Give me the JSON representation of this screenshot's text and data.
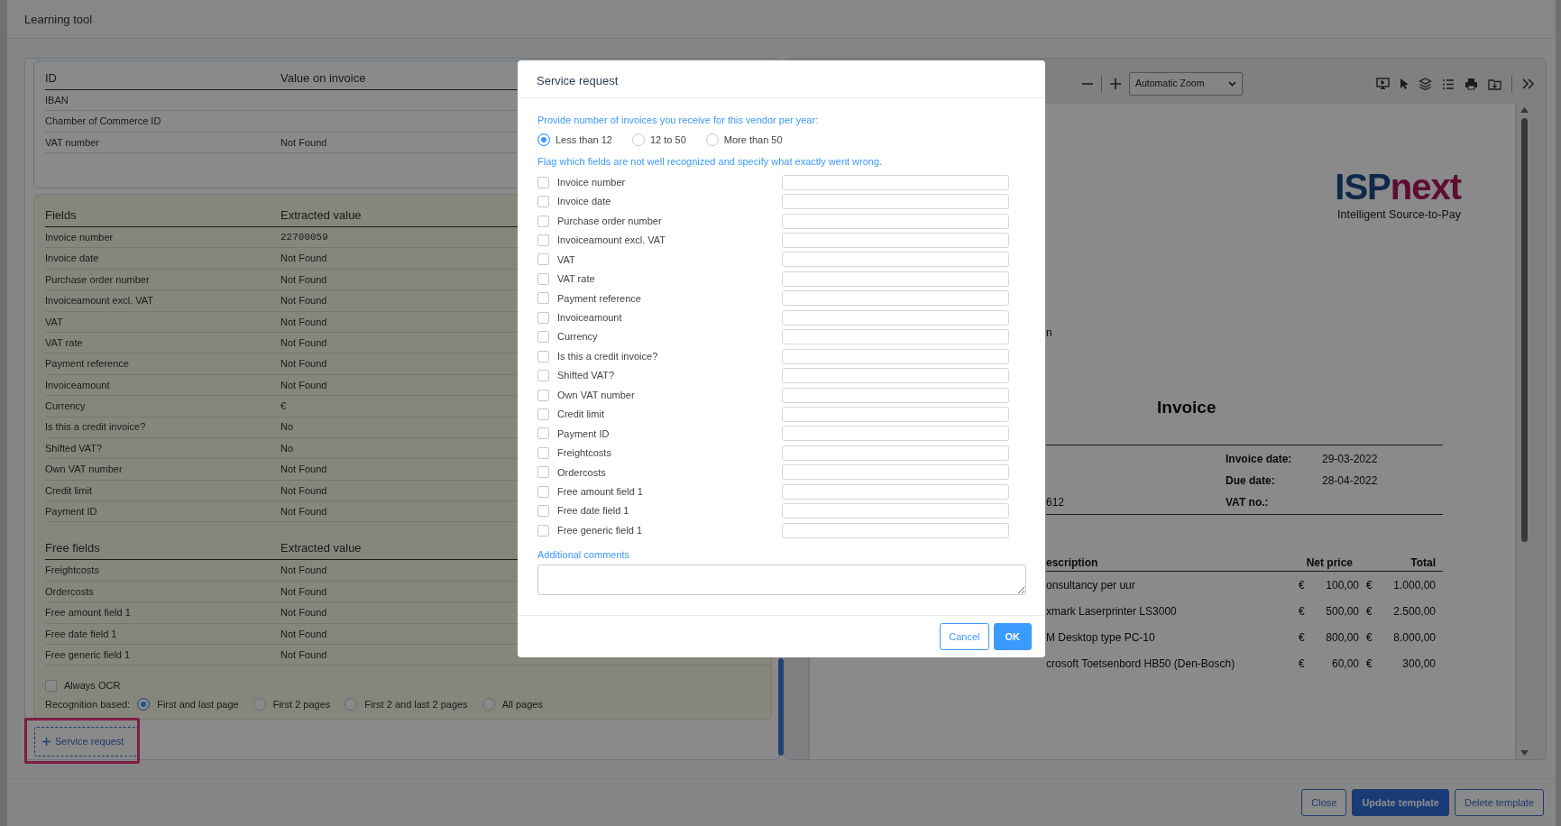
{
  "window": {
    "title": "Learning tool"
  },
  "id_table": {
    "columns": [
      "ID",
      "Value on invoice"
    ],
    "rows": [
      {
        "label": "IBAN"
      },
      {
        "label": "Chamber of Commerce ID"
      },
      {
        "label": "VAT number",
        "value": "Not Found"
      }
    ]
  },
  "fields_table": {
    "columns": [
      "Fields",
      "Extracted value"
    ],
    "rows": [
      {
        "label": "Invoice number",
        "value": "22700059"
      },
      {
        "label": "Invoice date",
        "value": "Not Found"
      },
      {
        "label": "Purchase order number",
        "value": "Not Found"
      },
      {
        "label": "Invoiceamount excl. VAT",
        "value": "Not Found"
      },
      {
        "label": "VAT",
        "value": "Not Found"
      },
      {
        "label": "VAT rate",
        "value": "Not Found"
      },
      {
        "label": "Payment reference",
        "value": "Not Found"
      },
      {
        "label": "Invoiceamount",
        "value": "Not Found"
      },
      {
        "label": "Currency",
        "value": "€"
      },
      {
        "label": "Is this a credit invoice?",
        "value": "No"
      },
      {
        "label": "Shifted VAT?",
        "value": "No"
      },
      {
        "label": "Own VAT number",
        "value": "Not Found"
      },
      {
        "label": "Credit limit",
        "value": "Not Found"
      },
      {
        "label": "Payment ID",
        "value": "Not Found"
      }
    ]
  },
  "free_fields_table": {
    "columns": [
      "Free fields",
      "Extracted value"
    ],
    "rows": [
      {
        "label": "Freightcosts",
        "value": "Not Found"
      },
      {
        "label": "Ordercosts",
        "value": "Not Found"
      },
      {
        "label": "Free amount field 1",
        "value": "Not Found"
      },
      {
        "label": "Free date field 1",
        "value": "Not Found"
      },
      {
        "label": "Free generic field 1",
        "value": "Not Found"
      }
    ]
  },
  "always_ocr": {
    "label": "Always OCR",
    "checked": false
  },
  "recognition": {
    "label": "Recognition based:",
    "options": [
      {
        "label": "First and last page",
        "selected": true
      },
      {
        "label": "First 2 pages",
        "selected": false
      },
      {
        "label": "First 2 and last 2 pages",
        "selected": false
      },
      {
        "label": "All pages",
        "selected": false
      }
    ]
  },
  "service_request_button": {
    "label": "Service request",
    "highlighted": true
  },
  "viewer": {
    "zoom": "Automatic Zoom",
    "document": {
      "logo_primary": "ISP",
      "logo_accent": "next",
      "tagline": "Intelligent Source-to-Pay",
      "fragment_1": "n",
      "title": "Invoice",
      "meta": [
        {
          "label": "Invoice date:",
          "value": "29-03-2022"
        },
        {
          "label": "Due date:",
          "value": "28-04-2022"
        },
        {
          "label": "VAT no.:"
        }
      ],
      "fragment_2": "612",
      "columns": [
        "escription",
        "Net price",
        "Total"
      ],
      "lines": [
        {
          "description": "onsultancy per uur",
          "currency_1": "€",
          "net_price": "100,00",
          "currency_2": "€",
          "total": "1.000,00"
        },
        {
          "description": "xmark Laserprinter LS3000",
          "currency_1": "€",
          "net_price": "500,00",
          "currency_2": "€",
          "total": "2.500,00"
        },
        {
          "description": "M Desktop type PC-10",
          "currency_1": "€",
          "net_price": "800,00",
          "currency_2": "€",
          "total": "8.000,00"
        },
        {
          "description": "crosoft Toetsenbord HB50 (Den-Bosch)",
          "currency_1": "€",
          "net_price": "60,00",
          "currency_2": "€",
          "total": "300,00"
        }
      ]
    }
  },
  "footer_buttons": [
    {
      "label": "Close",
      "kind": "outline"
    },
    {
      "label": "Update template",
      "kind": "primary"
    },
    {
      "label": "Delete template",
      "kind": "outline"
    }
  ],
  "dialog": {
    "title": "Service request",
    "frequency_prompt": "Provide number of invoices you receive for this vendor per year:",
    "frequency_options": [
      {
        "label": "Less than 12",
        "selected": true
      },
      {
        "label": "12 to 50",
        "selected": false
      },
      {
        "label": "More than 50",
        "selected": false
      }
    ],
    "flag_prompt": "Flag which fields are not well recognized and specify what exactly went wrong.",
    "flags": [
      {
        "label": "Invoice number",
        "checked": false
      },
      {
        "label": "Invoice date",
        "checked": false
      },
      {
        "label": "Purchase order number",
        "checked": false
      },
      {
        "label": "Invoiceamount excl. VAT",
        "checked": false
      },
      {
        "label": "VAT",
        "checked": false
      },
      {
        "label": "VAT rate",
        "checked": false
      },
      {
        "label": "Payment reference",
        "checked": false
      },
      {
        "label": "Invoiceamount",
        "checked": false
      },
      {
        "label": "Currency",
        "checked": false
      },
      {
        "label": "Is this a credit invoice?",
        "checked": false
      },
      {
        "label": "Shifted VAT?",
        "checked": false
      },
      {
        "label": "Own VAT number",
        "checked": false
      },
      {
        "label": "Credit limit",
        "checked": false
      },
      {
        "label": "Payment ID",
        "checked": false
      },
      {
        "label": "Freightcosts",
        "checked": false
      },
      {
        "label": "Ordercosts",
        "checked": false
      },
      {
        "label": "Free amount field 1",
        "checked": false
      },
      {
        "label": "Free date field 1",
        "checked": false
      },
      {
        "label": "Free generic field 1",
        "checked": false
      }
    ],
    "comments_label": "Additional comments",
    "buttons": [
      {
        "label": "Cancel",
        "kind": "outline"
      },
      {
        "label": "OK",
        "kind": "primary"
      }
    ]
  }
}
